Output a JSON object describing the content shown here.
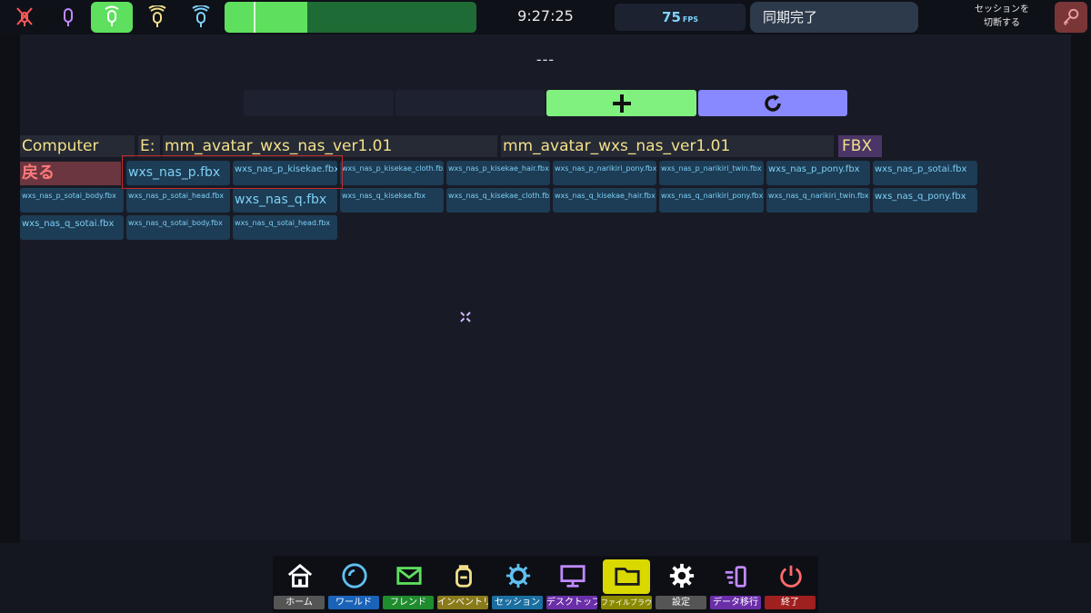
{
  "topbar": {
    "voice_modes": [
      {
        "name": "mute-icon",
        "color": "#ff5a5a"
      },
      {
        "name": "whisper-icon",
        "color": "#c08aff"
      },
      {
        "name": "normal-icon",
        "color": "#ffffff",
        "active": true
      },
      {
        "name": "shout-icon",
        "color": "#f2e089"
      },
      {
        "name": "broadcast-icon",
        "color": "#7fd3ff"
      }
    ],
    "mic_level": 0.33,
    "clock": "9:27:25",
    "fps_value": "75",
    "fps_unit": "FPS",
    "sync_status": "同期完了",
    "session_switch_line1": "セッションを",
    "session_switch_line2": "切断する",
    "session_switch_icon": "key-icon"
  },
  "browser": {
    "path_text": "---",
    "add_icon": "plus-icon",
    "refresh_icon": "refresh-icon",
    "breadcrumb": [
      "Computer",
      "E:",
      "mm_avatar_wxs_nas_ver1.01",
      "mm_avatar_wxs_nas_ver1.01"
    ],
    "extension_filter": "FBX",
    "back_label": "戻る",
    "files": [
      "wxs_nas_p.fbx",
      "wxs_nas_p_kisekae.fbx",
      "wxs_nas_p_kisekae_cloth.fbx",
      "wxs_nas_p_kisekae_hair.fbx",
      "wxs_nas_p_narikiri_pony.fbx",
      "wxs_nas_p_narikiri_twin.fbx",
      "wxs_nas_p_pony.fbx",
      "wxs_nas_p_sotai.fbx",
      "wxs_nas_p_sotai_body.fbx",
      "wxs_nas_p_sotai_head.fbx",
      "wxs_nas_q.fbx",
      "wxs_nas_q_kisekae.fbx",
      "wxs_nas_q_kisekae_cloth.fbx",
      "wxs_nas_q_kisekae_hair.fbx",
      "wxs_nas_q_narikiri_pony.fbx",
      "wxs_nas_q_narikiri_twin.fbx",
      "wxs_nas_q_pony.fbx",
      "wxs_nas_q_sotai.fbx",
      "wxs_nas_q_sotai_body.fbx",
      "wxs_nas_q_sotai_head.fbx"
    ]
  },
  "dock": [
    {
      "label": "ホーム",
      "icon": "home-icon",
      "label_bg": "#555555"
    },
    {
      "label": "ワールド",
      "icon": "globe-icon",
      "label_bg": "#1a63b8"
    },
    {
      "label": "フレンド",
      "icon": "envelope-icon",
      "label_bg": "#1f8c2e"
    },
    {
      "label": "インベントリ",
      "icon": "backpack-icon",
      "label_bg": "#8a7b1a"
    },
    {
      "label": "セッション",
      "icon": "gear-network-icon",
      "label_bg": "#1a6fa0"
    },
    {
      "label": "デスクトップ",
      "icon": "monitor-icon",
      "label_bg": "#6a2fa8"
    },
    {
      "label": "ファイルブラウザ",
      "icon": "folder-icon",
      "label_bg": "#8a8a00",
      "active": true
    },
    {
      "label": "設定",
      "icon": "settings-icon",
      "label_bg": "#555555"
    },
    {
      "label": "データ移行",
      "icon": "migrate-icon",
      "label_bg": "#6a2fa8"
    },
    {
      "label": "終了",
      "icon": "power-icon",
      "label_bg": "#a01f1f"
    }
  ]
}
